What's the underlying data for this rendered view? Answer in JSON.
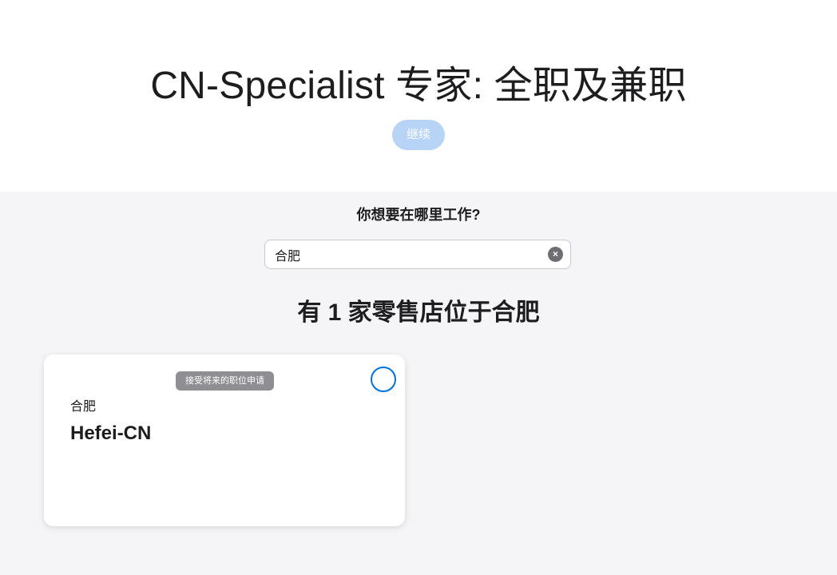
{
  "header": {
    "title": "CN-Specialist 专家: 全职及兼职",
    "continue_label": "继续"
  },
  "search": {
    "question": "你想要在哪里工作?",
    "value": "合肥",
    "clear_icon": "clear-icon"
  },
  "results": {
    "heading": "有 1 家零售店位于合肥",
    "stores": [
      {
        "badge": "接受将来的职位申请",
        "city": "合肥",
        "name": "Hefei-CN",
        "selected": false
      }
    ]
  },
  "colors": {
    "accent": "#0071e3",
    "continue_disabled": "#b7d4f7",
    "badge": "#8e8e93"
  }
}
